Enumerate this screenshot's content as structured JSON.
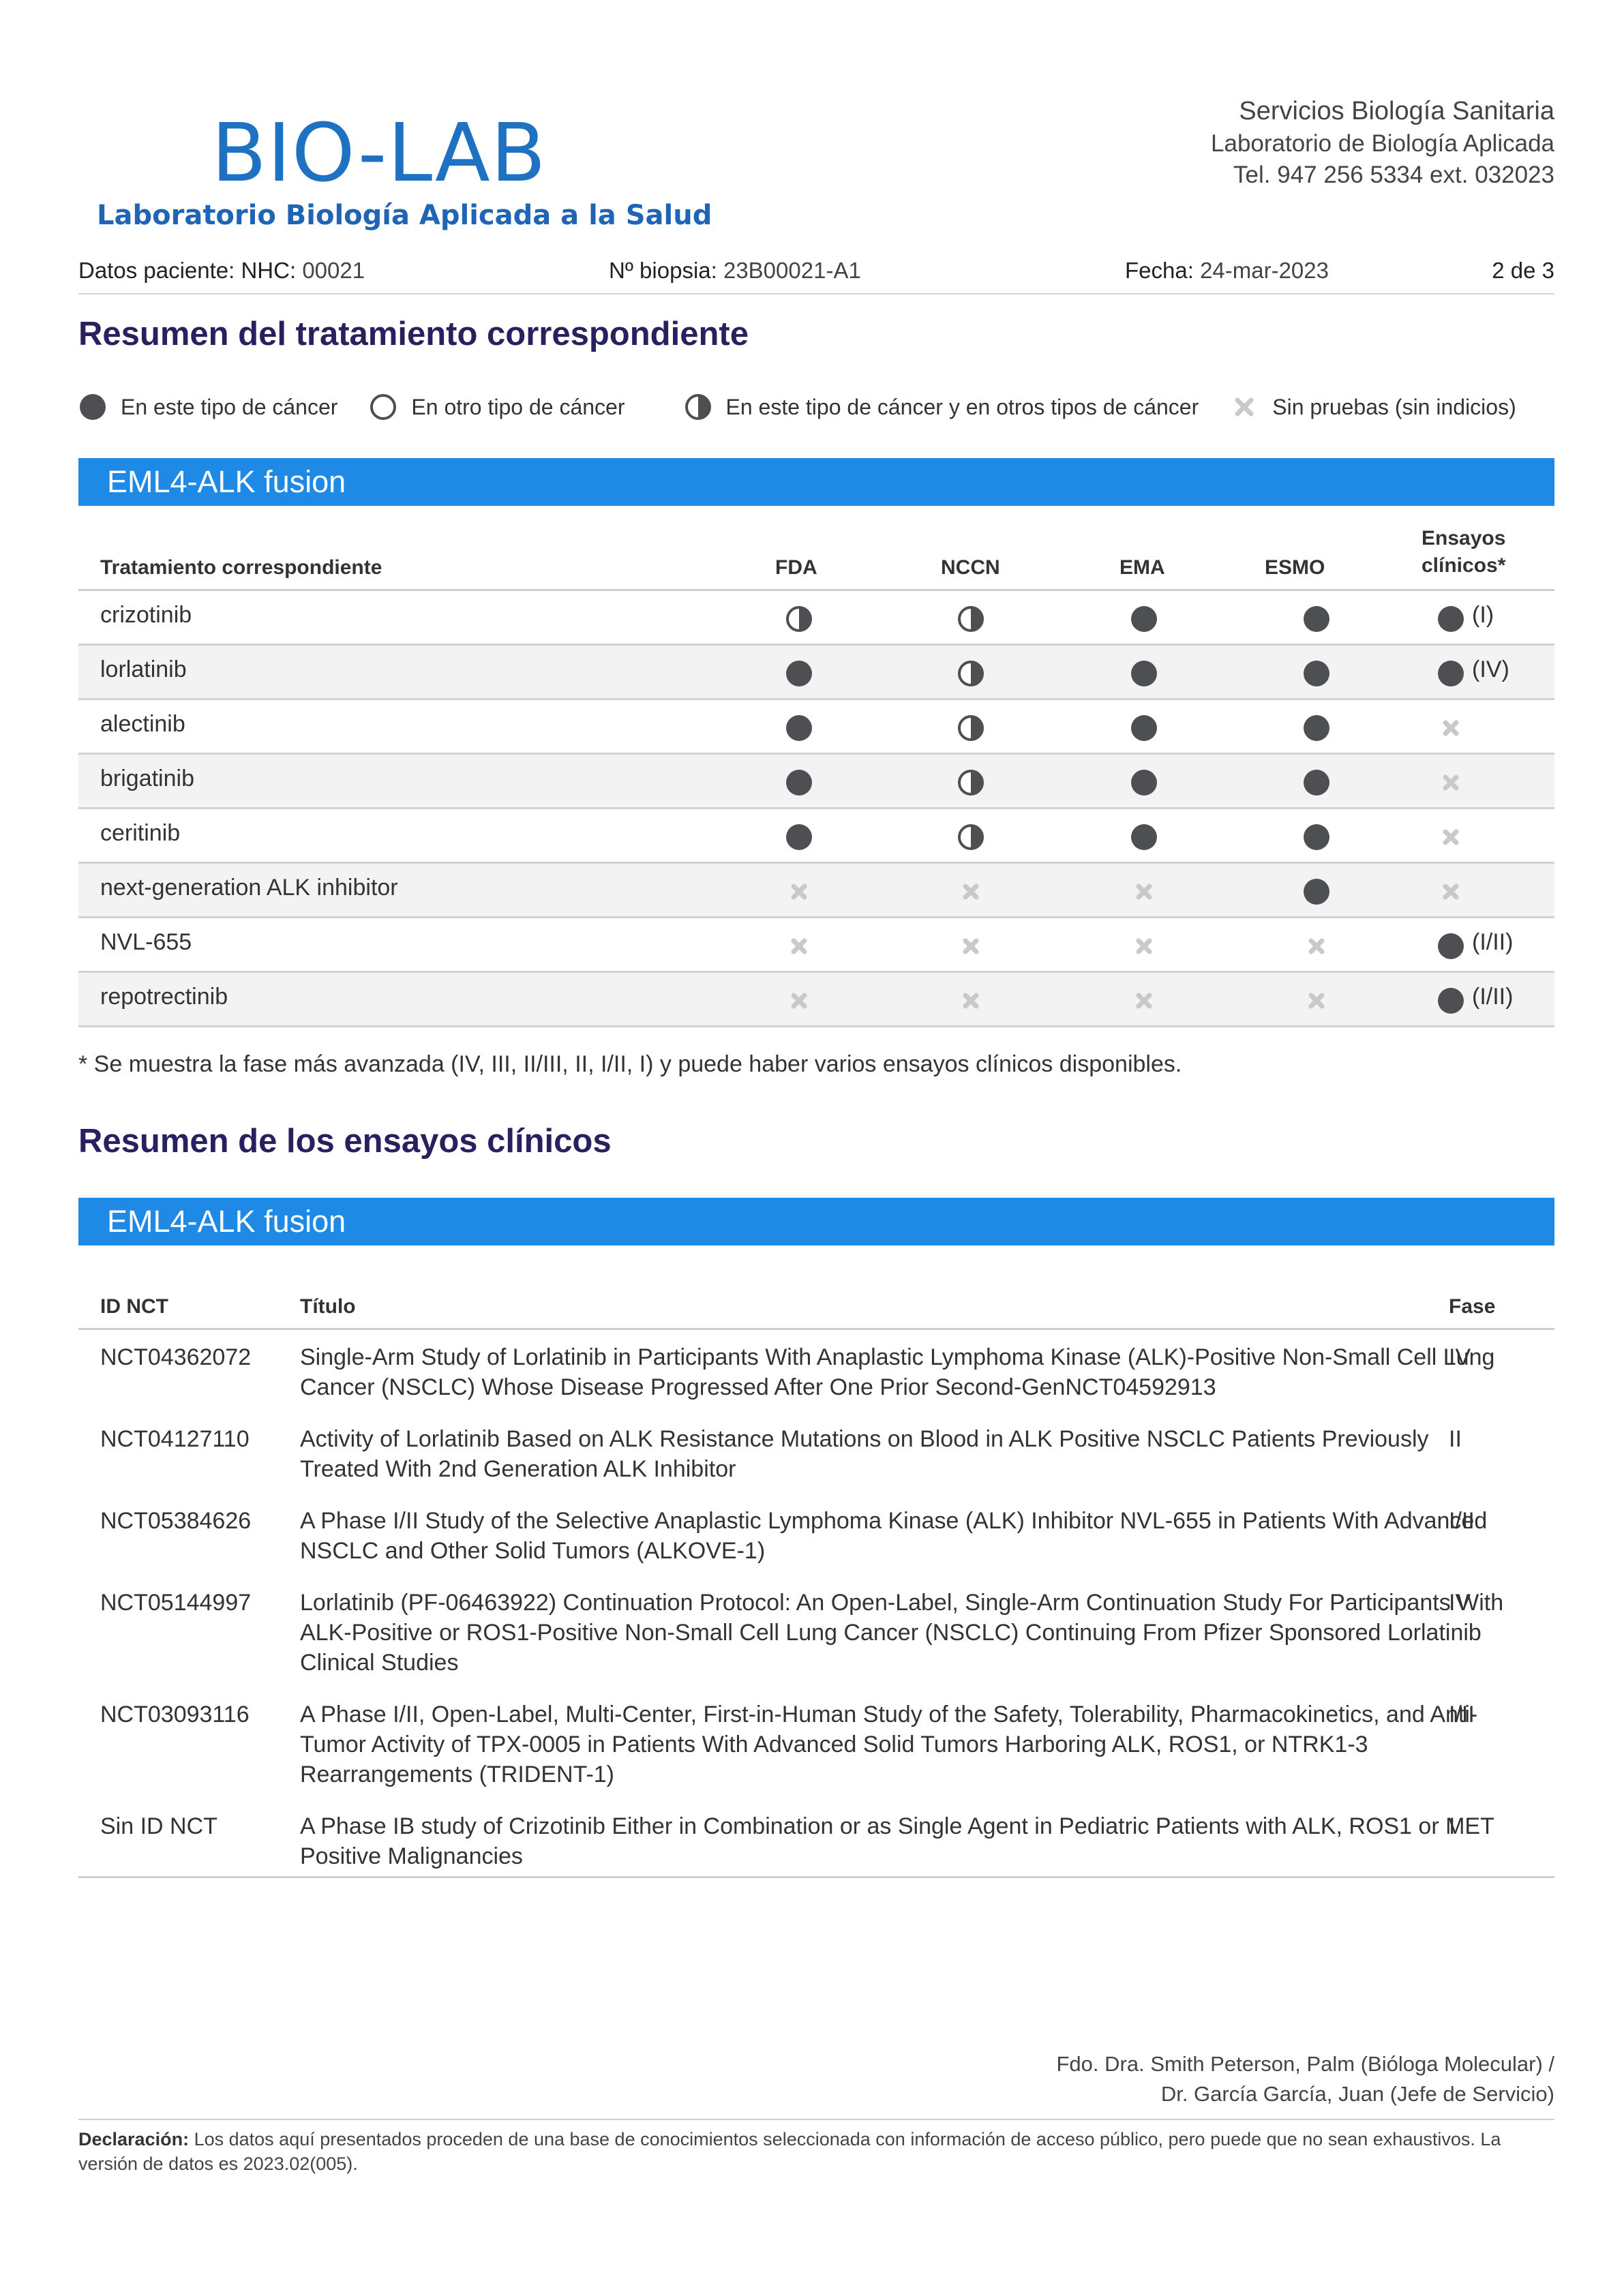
{
  "header": {
    "logo_title": "BIO-LAB",
    "logo_subtitle": "Laboratorio Biología Aplicada a la Salud",
    "org_line1": "Servicios Biología Sanitaria",
    "org_line2": "Laboratorio de Biología Aplicada",
    "org_line3": "Tel. 947 256 5334 ext. 032023"
  },
  "meta": {
    "patient_label": "Datos paciente: NHC:",
    "patient_value": "00021",
    "biopsy_label": "Nº biopsia:",
    "biopsy_value": "23B00021-A1",
    "date_label": "Fecha:",
    "date_value": "24-mar-2023",
    "page": "2 de 3"
  },
  "treatment_section": {
    "title": "Resumen del tratamiento correspondiente",
    "legend": [
      {
        "icon": "filled-circle",
        "label": "En este tipo de cáncer"
      },
      {
        "icon": "empty-circle",
        "label": "En otro tipo de cáncer"
      },
      {
        "icon": "half-circle",
        "label": "En este tipo de cáncer y en otros tipos de cáncer"
      },
      {
        "icon": "x-mark",
        "label": "Sin pruebas (sin indicios)"
      }
    ],
    "bar_title": "EML4-ALK fusion",
    "columns": {
      "treatment": "Tratamiento correspondiente",
      "fda": "FDA",
      "nccn": "NCCN",
      "ema": "EMA",
      "esmo": "ESMO",
      "trials_line1": "Ensayos",
      "trials_line2": "clínicos*"
    },
    "rows": [
      {
        "name": "crizotinib",
        "fda": "half",
        "nccn": "half",
        "ema": "full",
        "esmo": "full",
        "trials": "full",
        "phase": "(I)"
      },
      {
        "name": "lorlatinib",
        "fda": "full",
        "nccn": "half",
        "ema": "full",
        "esmo": "full",
        "trials": "full",
        "phase": "(IV)"
      },
      {
        "name": "alectinib",
        "fda": "full",
        "nccn": "half",
        "ema": "full",
        "esmo": "full",
        "trials": "x",
        "phase": ""
      },
      {
        "name": "brigatinib",
        "fda": "full",
        "nccn": "half",
        "ema": "full",
        "esmo": "full",
        "trials": "x",
        "phase": ""
      },
      {
        "name": "ceritinib",
        "fda": "full",
        "nccn": "half",
        "ema": "full",
        "esmo": "full",
        "trials": "x",
        "phase": ""
      },
      {
        "name": "next-generation ALK inhibitor",
        "fda": "x",
        "nccn": "x",
        "ema": "x",
        "esmo": "full",
        "trials": "x",
        "phase": ""
      },
      {
        "name": "NVL-655",
        "fda": "x",
        "nccn": "x",
        "ema": "x",
        "esmo": "x",
        "trials": "full",
        "phase": "(I/II)"
      },
      {
        "name": "repotrectinib",
        "fda": "x",
        "nccn": "x",
        "ema": "x",
        "esmo": "x",
        "trials": "full",
        "phase": "(I/II)"
      }
    ],
    "footnote": "* Se muestra la fase más avanzada (IV, III, II/III, II, I/II, I) y puede haber varios ensayos clínicos disponibles."
  },
  "trials_section": {
    "title": "Resumen de los ensayos clínicos",
    "bar_title": "EML4-ALK fusion",
    "columns": {
      "id": "ID NCT",
      "title": "Título",
      "phase": "Fase"
    },
    "rows": [
      {
        "id": "NCT04362072",
        "title": "Single-Arm Study of Lorlatinib in Participants With Anaplastic Lymphoma Kinase (ALK)-Positive Non-Small Cell Lung Cancer (NSCLC) Whose Disease Progressed After One Prior Second-GenNCT04592913",
        "phase": "IV"
      },
      {
        "id": "NCT04127110",
        "title": "Activity of Lorlatinib Based on ALK Resistance Mutations on Blood in ALK Positive NSCLC Patients Previously Treated With 2nd Generation ALK Inhibitor",
        "phase": "II"
      },
      {
        "id": "NCT05384626",
        "title": "A Phase I/II Study of the Selective Anaplastic Lymphoma Kinase (ALK) Inhibitor NVL-655 in Patients With Advanced NSCLC and Other Solid Tumors (ALKOVE-1)",
        "phase": "I/II"
      },
      {
        "id": "NCT05144997",
        "title": "Lorlatinib (PF-06463922) Continuation Protocol: An Open-Label, Single-Arm Continuation Study For Participants With ALK-Positive or ROS1-Positive Non-Small Cell Lung Cancer (NSCLC) Continuing From Pfizer Sponsored Lorlatinib Clinical Studies",
        "phase": "IV"
      },
      {
        "id": "NCT03093116",
        "title": "A Phase I/II, Open-Label, Multi-Center, First-in-Human Study of the Safety, Tolerability, Pharmacokinetics, and Anti-Tumor Activity of TPX-0005 in Patients With Advanced Solid Tumors Harboring ALK, ROS1, or NTRK1-3 Rearrangements (TRIDENT-1)",
        "phase": "I/II"
      },
      {
        "id": "Sin ID NCT",
        "title": "A Phase IB study of Crizotinib Either in Combination or as Single Agent in Pediatric Patients with ALK, ROS1 or MET Positive Malignancies",
        "phase": "I"
      }
    ]
  },
  "signature": {
    "line1": "Fdo. Dra. Smith Peterson, Palm (Bióloga Molecular) /",
    "line2": "Dr. García García, Juan (Jefe de Servicio)"
  },
  "declaration": {
    "label": "Declaración:",
    "text": "Los datos aquí presentados proceden de una base de conocimientos seleccionada con información de acceso público, pero puede que no sean exhaustivos. La versión de datos es 2023.02(005)."
  },
  "colors": {
    "brand_blue": "#1f72c1",
    "section_bar": "#1f8ae6",
    "heading": "#27215f",
    "symbol": "#4d4f53",
    "x_mark": "#c9c9c9"
  }
}
